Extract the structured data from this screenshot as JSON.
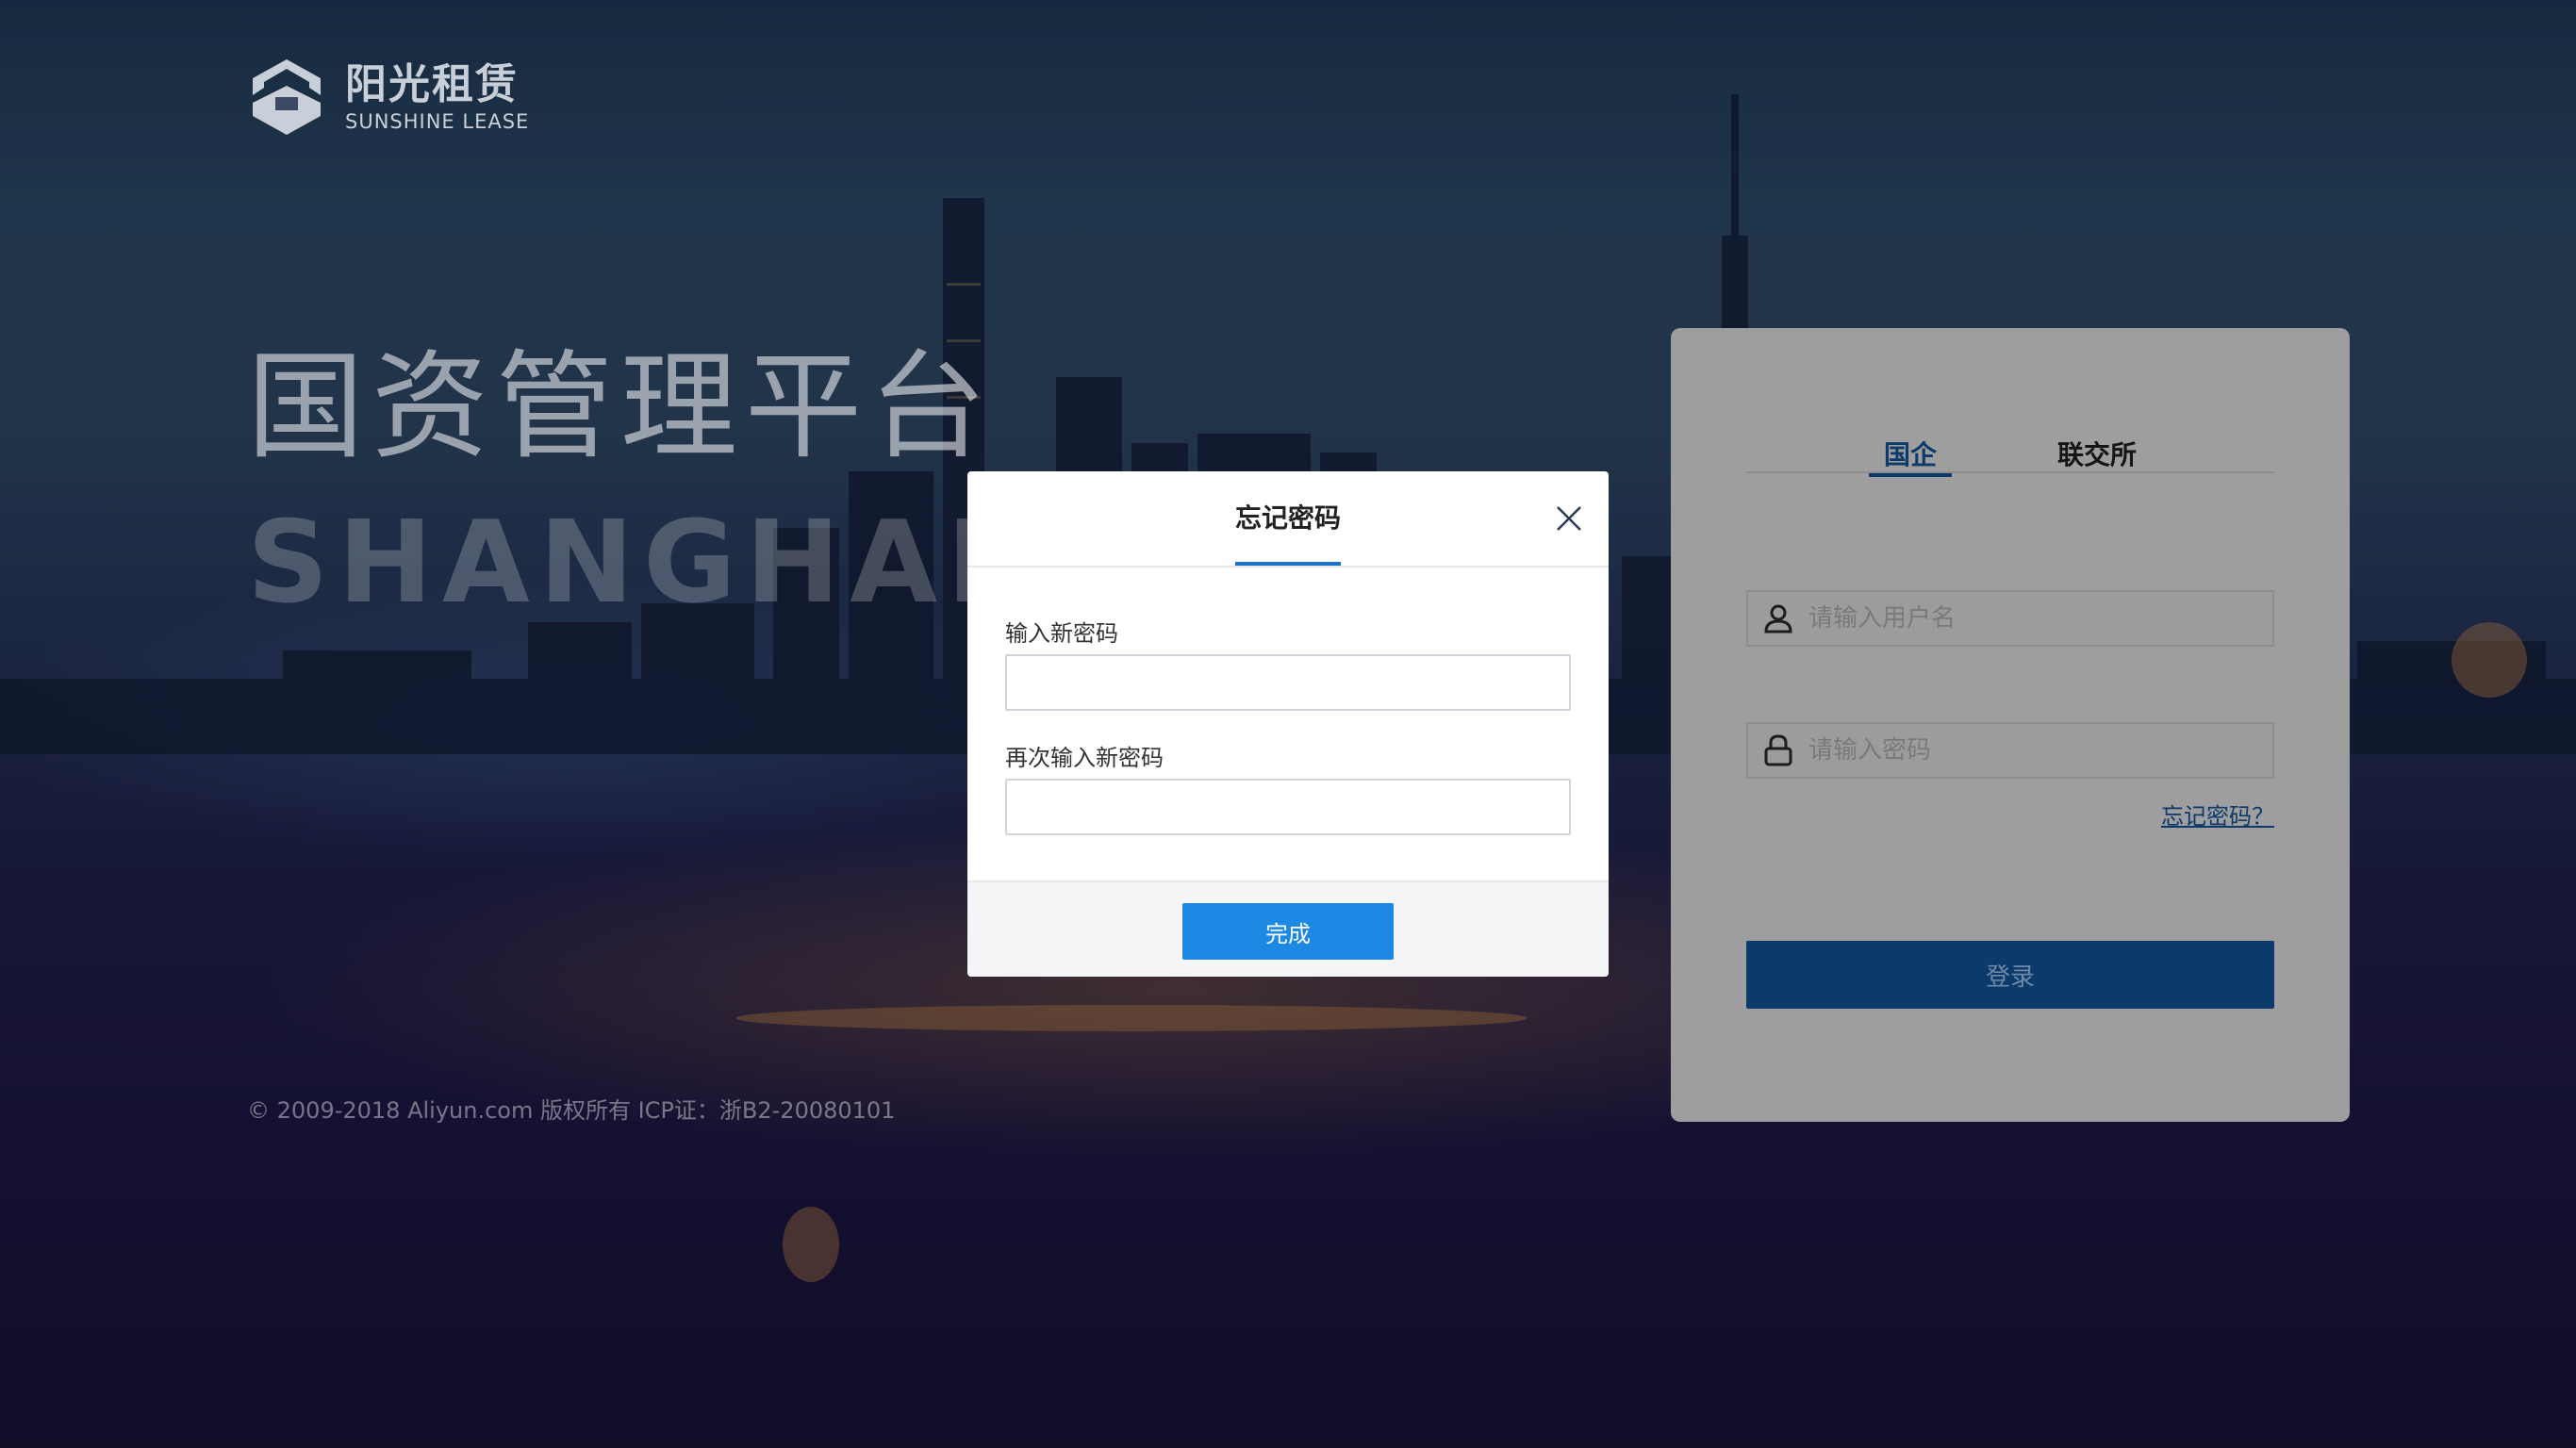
{
  "brand": {
    "name_cn": "阳光租赁",
    "name_en": "SUNSHINE LEASE",
    "icon": "house-shield-icon"
  },
  "hero": {
    "title": "国资管理平台",
    "city": "SHANGHAI"
  },
  "footer": {
    "copyright": "© 2009-2018 Aliyun.com 版权所有 ICP证：浙B2-20080101"
  },
  "login": {
    "tabs": [
      {
        "label": "国企",
        "active": true
      },
      {
        "label": "联交所",
        "active": false
      }
    ],
    "username": {
      "placeholder": "请输入用户名",
      "value": "",
      "icon": "user-icon"
    },
    "password": {
      "placeholder": "请输入密码",
      "value": "",
      "icon": "lock-icon"
    },
    "forgot_label": "忘记密码？",
    "submit_label": "登录"
  },
  "modal": {
    "title": "忘记密码",
    "close_icon": "close-icon",
    "fields": [
      {
        "label": "输入新密码",
        "value": ""
      },
      {
        "label": "再次输入新密码",
        "value": ""
      }
    ],
    "submit_label": "完成"
  },
  "colors": {
    "primary": "#1e88e5",
    "login_primary": "#0b3a6b",
    "tab_active": "#0b3a6b",
    "modal_accent": "#1a73c6"
  }
}
